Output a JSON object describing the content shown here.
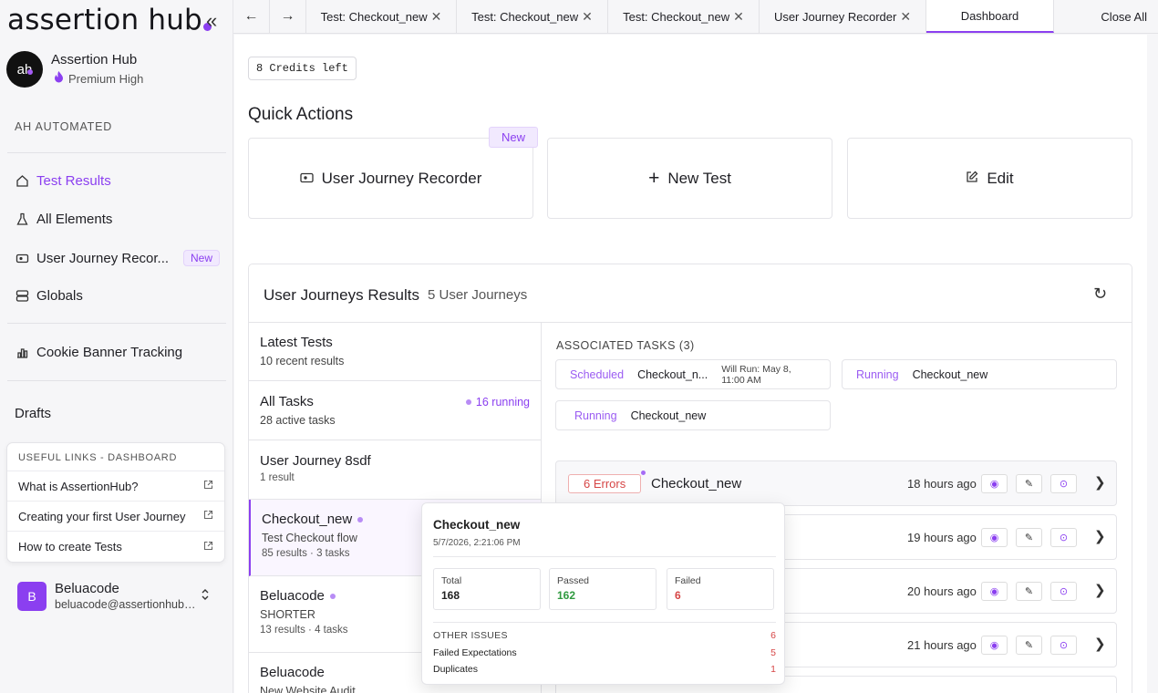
{
  "sidebar": {
    "logo": "assertion hub",
    "collapse": "«",
    "org": {
      "initials": "ah",
      "name": "Assertion Hub",
      "plan": "Premium High"
    },
    "section": "AH AUTOMATED",
    "nav": [
      {
        "label": "Test Results",
        "icon": "home-icon",
        "active": true
      },
      {
        "label": "All Elements",
        "icon": "flask-icon"
      },
      {
        "label": "User Journey Recor...",
        "icon": "video-icon",
        "badge": "New"
      },
      {
        "label": "Globals",
        "icon": "database-icon"
      },
      {
        "label": "Cookie Banner Tracking",
        "icon": "bar-chart-icon"
      }
    ],
    "drafts": "Drafts",
    "links": {
      "title": "USEFUL LINKS - DASHBOARD",
      "items": [
        "What is AssertionHub?",
        "Creating your first User Journey",
        "How to create Tests"
      ]
    },
    "user": {
      "initial": "B",
      "name": "Beluacode",
      "email": "beluacode@assertionhub.com"
    }
  },
  "tabs": {
    "items": [
      "Test: Checkout_new",
      "Test: Checkout_new",
      "Test: Checkout_new",
      "User Journey Recorder",
      "Dashboard"
    ],
    "close_all": "Close All"
  },
  "main": {
    "credits": "8 Credits left",
    "quick_actions": {
      "title": "Quick Actions",
      "recorder": "User Journey Recorder",
      "new_badge": "New",
      "new_test": "New Test",
      "edit": "Edit"
    },
    "results": {
      "title": "User Journeys Results",
      "count": "5 User Journeys",
      "list": [
        {
          "title": "Latest Tests",
          "sub": "10 recent results"
        },
        {
          "title": "All Tasks",
          "sub": "28 active tasks",
          "tag": "16 running"
        },
        {
          "title": "User Journey 8sdf",
          "sub": "1 result"
        },
        {
          "title": "Checkout_new",
          "sub": "Test Checkout flow",
          "sub2": "85 results · 3 tasks"
        },
        {
          "title": "Beluacode",
          "sub": "SHORTER",
          "sub2": "13 results · 4 tasks"
        },
        {
          "title": "Beluacode",
          "sub": "New Website Audit"
        }
      ],
      "associated": {
        "label": "ASSOCIATED TASKS (3)",
        "tasks": [
          {
            "status": "Scheduled",
            "name": "Checkout_n...",
            "meta": "Will Run: May 8, 11:00 AM"
          },
          {
            "status": "Running",
            "name": "Checkout_new"
          },
          {
            "status": "Running",
            "name": "Checkout_new"
          }
        ]
      },
      "runs": [
        {
          "errors": "6 Errors",
          "name": "Checkout_new",
          "time": "18 hours ago"
        },
        {
          "time": "19 hours ago"
        },
        {
          "time": "20 hours ago"
        },
        {
          "time": "21 hours ago"
        }
      ]
    },
    "popover": {
      "title": "Checkout_new",
      "date": "5/7/2026, 2:21:06 PM",
      "total_label": "Total",
      "total": "168",
      "passed_label": "Passed",
      "passed": "162",
      "failed_label": "Failed",
      "failed": "6",
      "other_label": "OTHER ISSUES",
      "other": "6",
      "issues": [
        {
          "label": "Failed Expectations",
          "n": "5"
        },
        {
          "label": "Duplicates",
          "n": "1"
        }
      ]
    }
  },
  "colors": {
    "accent": "#8b3ff0",
    "error": "#d64545",
    "success": "#2f9a3f"
  }
}
